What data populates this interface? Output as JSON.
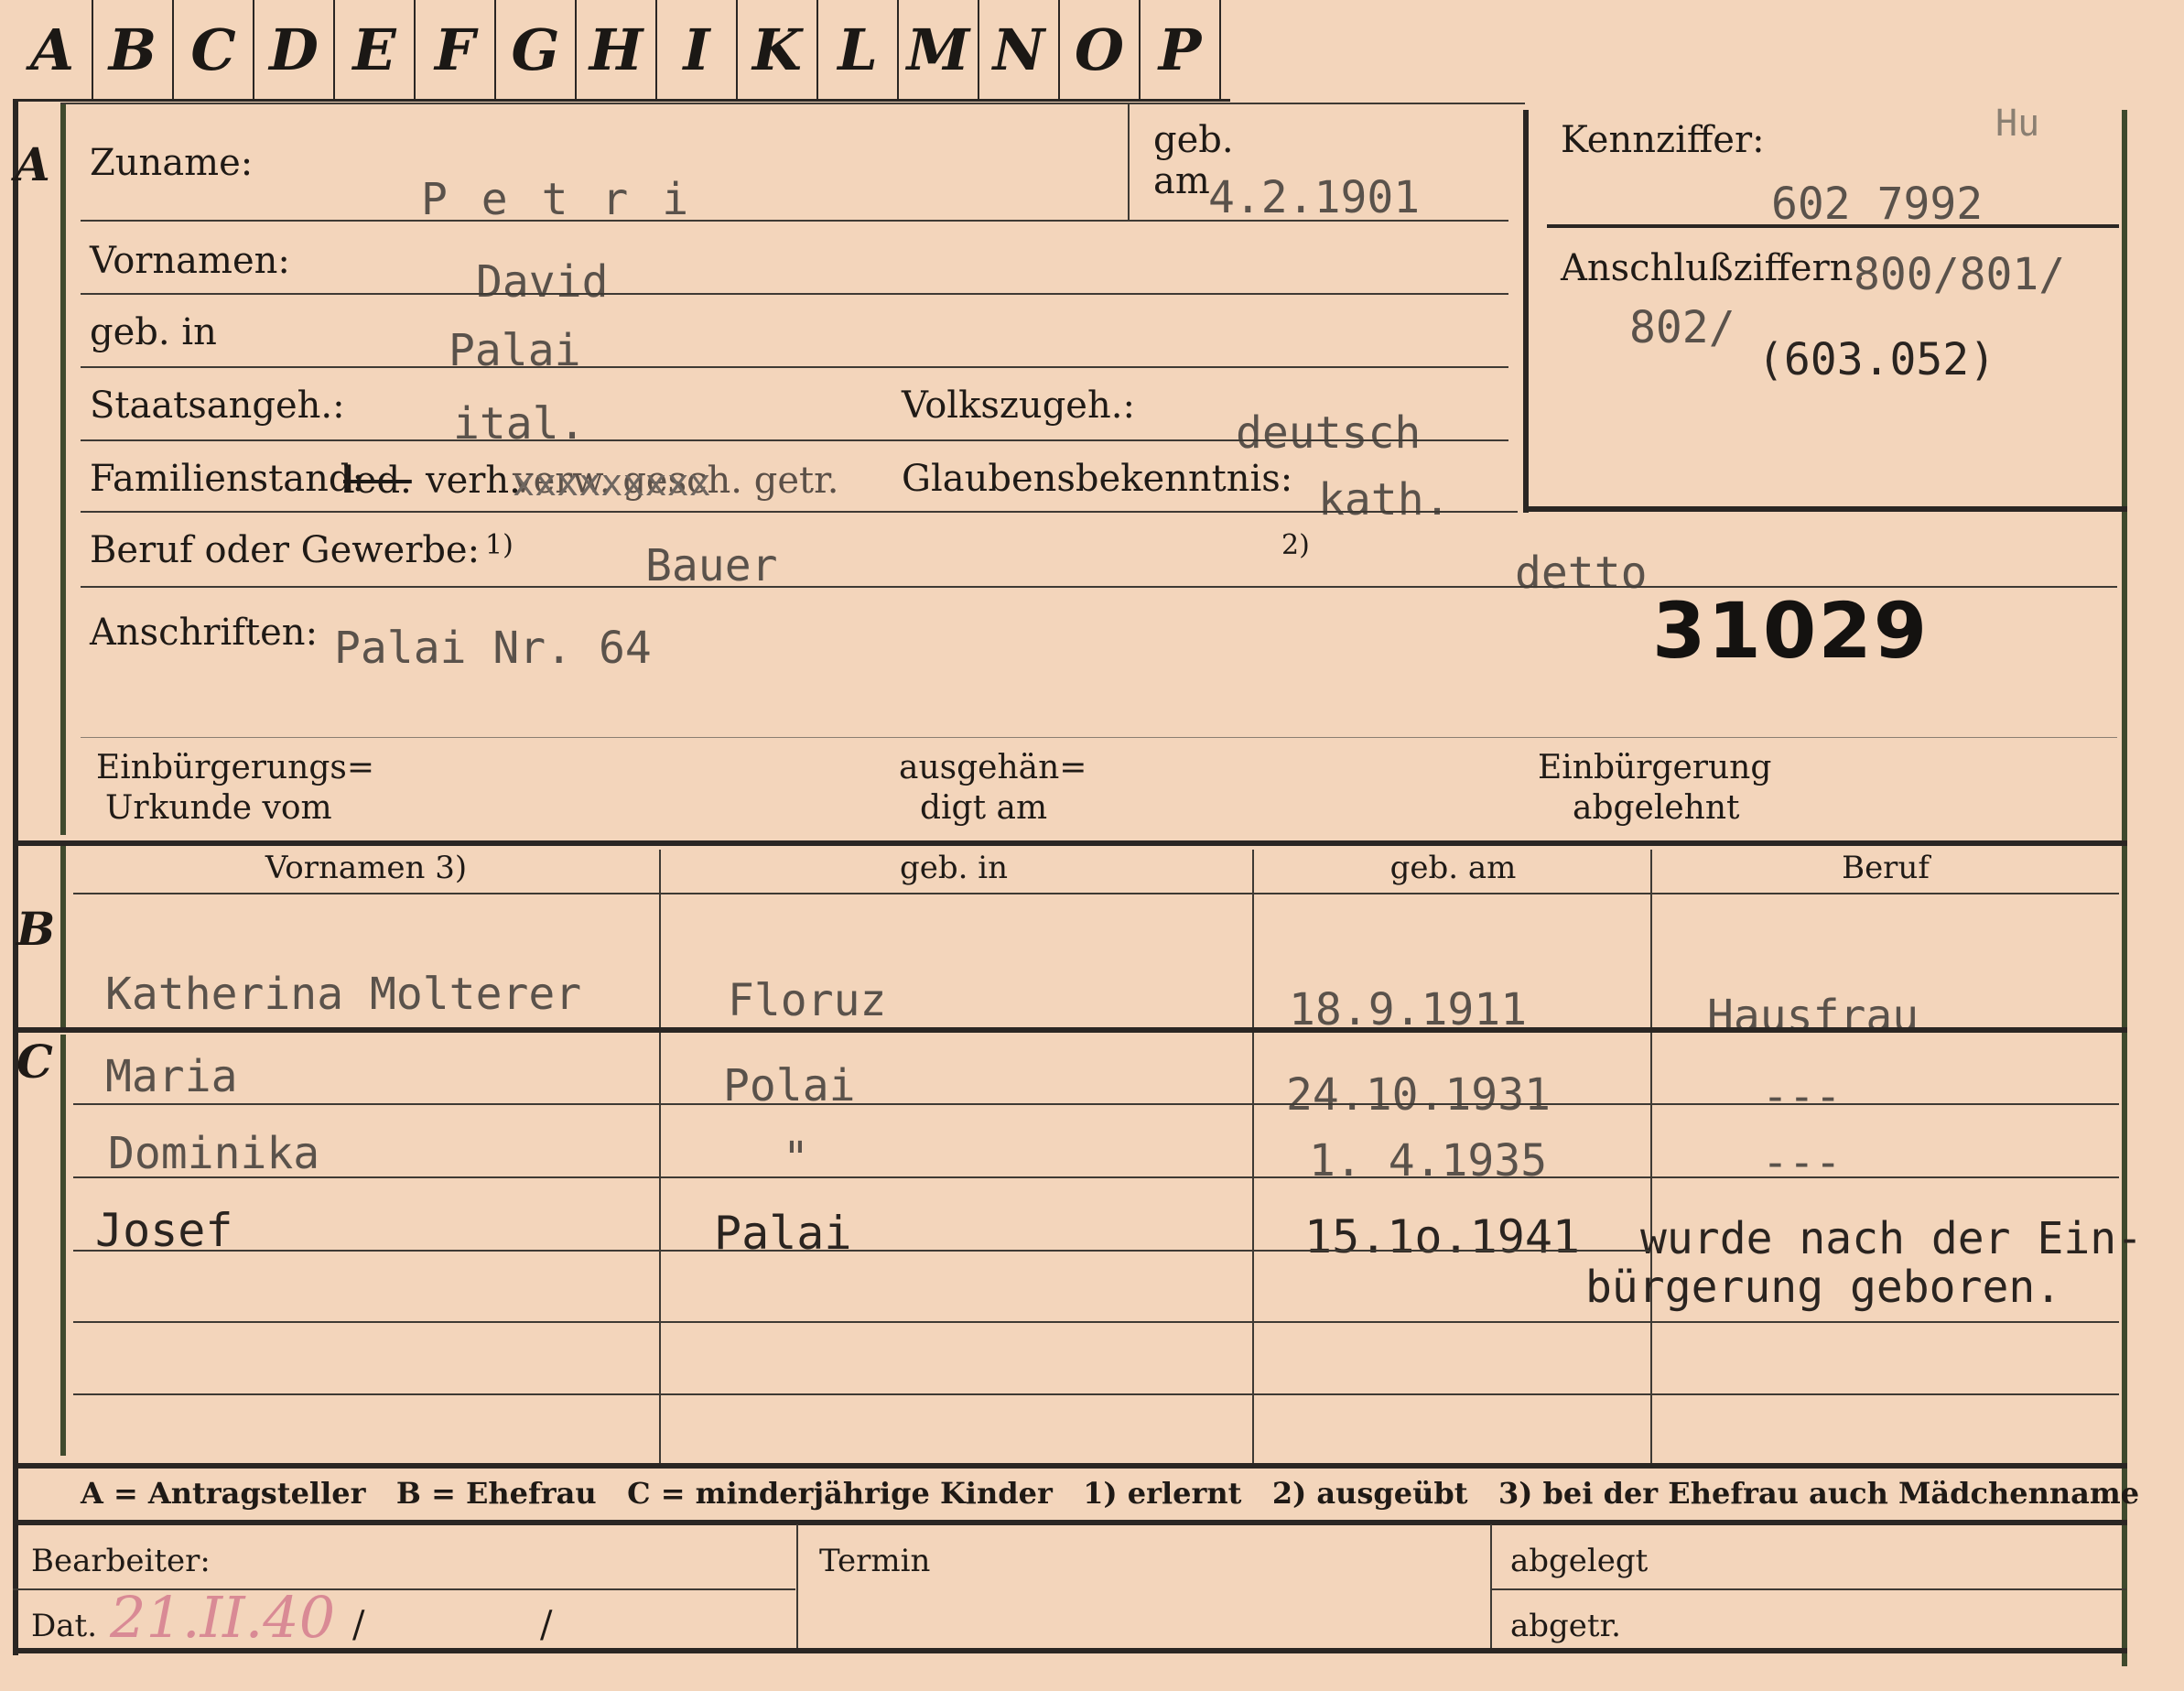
{
  "tabs": [
    "A",
    "B",
    "C",
    "D",
    "E",
    "F",
    "G",
    "H",
    "I",
    "K",
    "L",
    "M",
    "N",
    "O",
    "P"
  ],
  "sections": {
    "a": "A",
    "b": "B",
    "c": "C"
  },
  "applicant": {
    "surname_label": "Zuname:",
    "surname": "P e t r i",
    "birth_date_label_1": "geb.",
    "birth_date_label_2": "am",
    "birth_date": "4.2.1901",
    "given_names_label": "Vornamen:",
    "given_names": "David",
    "birthplace_label": "geb. in",
    "birthplace": "Palai",
    "nationality_label": "Staatsangeh.:",
    "nationality": "ital.",
    "ethnicity_label": "Volkszugeh.:",
    "ethnicity": "deutsch",
    "marital_label": "Familienstand:",
    "marital_led": "led.",
    "marital_verh": "verh.",
    "marital_rest": "verw. gesch. getr.",
    "marital_overtype": "xxxxxxxxx",
    "religion_label": "Glaubensbekenntnis:",
    "religion": "kath.",
    "profession_label": "Beruf oder Gewerbe:",
    "profession_marker_1": "1)",
    "profession_learned": "Bauer",
    "profession_marker_2": "2)",
    "profession_practiced": "detto",
    "address_label": "Anschriften:",
    "address": "Palai Nr. 64",
    "file_number": "31029",
    "naturalization_cert_label_1": "Einbürgerungs=",
    "naturalization_cert_label_2": "Urkunde vom",
    "handed_over_label_1": "ausgehän=",
    "handed_over_label_2": "digt am",
    "naturalization_denied_label_1": "Einbürgerung",
    "naturalization_denied_label_2": "abgelehnt"
  },
  "reference": {
    "code_label": "Kennziffer:",
    "code_note": "Hu",
    "code": "602 7992",
    "followup_label": "Anschlußziffern:",
    "followup_1": "800/801/",
    "followup_2": "802/",
    "followup_3": "(603.052)"
  },
  "table": {
    "headers": [
      "Vornamen 3)",
      "geb. in",
      "geb. am",
      "Beruf"
    ],
    "wife": {
      "name": "Katherina Molterer",
      "place": "Floruz",
      "date": "18.9.1911",
      "profession": "Hausfrau"
    },
    "children": [
      {
        "name": "Maria",
        "place": "Polai",
        "date": "24.10.1931",
        "profession": "---"
      },
      {
        "name": "Dominika",
        "place": "\"",
        "date": "1. 4.1935",
        "profession": "---"
      },
      {
        "name": "Josef",
        "place": "Palai",
        "date": "15.1o.1941",
        "profession": ""
      }
    ],
    "note_1": "wurde nach der Ein-",
    "note_2": "bürgerung geboren."
  },
  "legend": "A = Antragsteller   B = Ehefrau   C = minderjährige Kinder   1) erlernt   2) ausgeübt   3) bei der Ehefrau auch Mädchenname",
  "footer": {
    "clerk_label": "Bearbeiter:",
    "date_label": "Dat.",
    "date_value": "21.II.40",
    "slash_1": "/",
    "slash_2": "/",
    "term_label": "Termin",
    "filed_label": "abgelegt",
    "separated_label": "abgetr."
  }
}
